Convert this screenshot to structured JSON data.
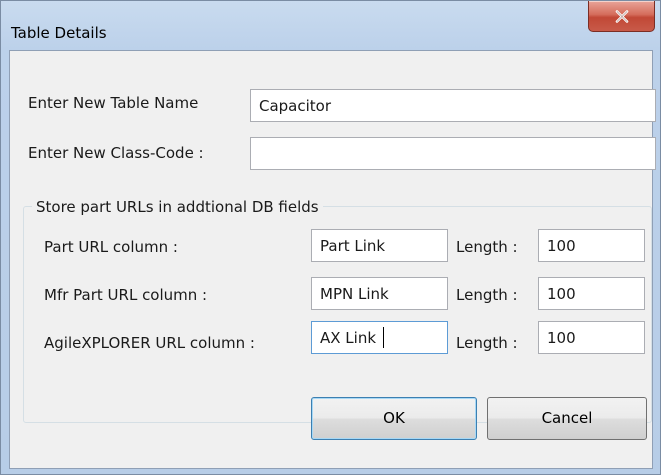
{
  "window": {
    "title": "Table Details",
    "close_icon": "close-icon"
  },
  "form": {
    "table_name_label": "Enter New Table Name",
    "table_name_value": "Capacitor",
    "class_code_label": "Enter New Class-Code :",
    "class_code_value": ""
  },
  "url_group": {
    "legend": "Store part URLs in addtional DB fields",
    "rows": [
      {
        "label": "Part URL column :",
        "value": "Part Link",
        "length_label": "Length :",
        "length_value": "100"
      },
      {
        "label": "Mfr Part URL column :",
        "value": "MPN Link",
        "length_label": "Length :",
        "length_value": "100"
      },
      {
        "label": "AgileXPLORER URL column :",
        "value": "AX Link",
        "length_label": "Length :",
        "length_value": "100"
      }
    ]
  },
  "buttons": {
    "ok_label": "OK",
    "cancel_label": "Cancel"
  },
  "colors": {
    "title_bar": "#bcd1ea",
    "close_button": "#c85a49",
    "client_background": "#f0f0f0",
    "focus_border": "#5d9bd5"
  }
}
